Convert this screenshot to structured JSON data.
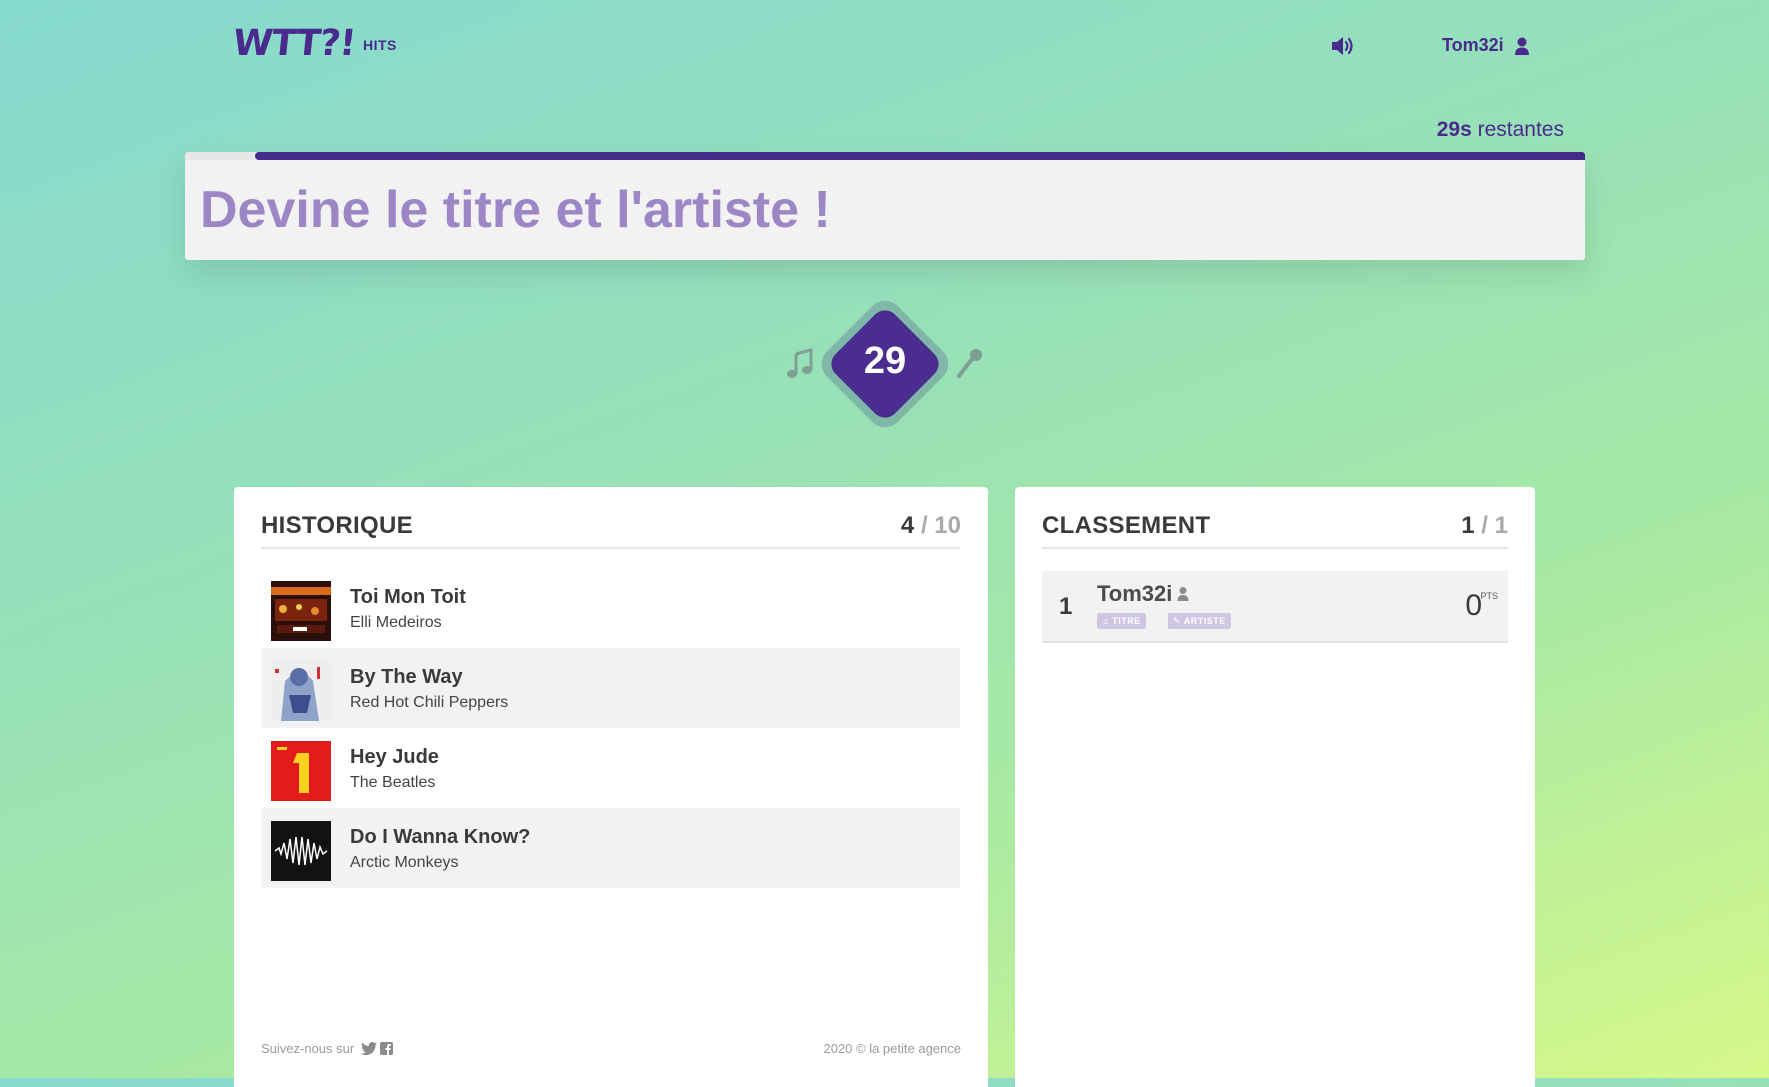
{
  "header": {
    "logo_text": "WTT?!",
    "logo_sub": "HITS",
    "username": "Tom32i"
  },
  "timer": {
    "seconds_label": "29s",
    "remaining_word": "restantes",
    "progress_fraction": 0.95
  },
  "question": {
    "text": "Devine le titre et l'artiste !"
  },
  "counter": {
    "value": "29"
  },
  "history": {
    "title": "HISTORIQUE",
    "current": "4",
    "separator": "/",
    "total": "10",
    "items": [
      {
        "title": "Toi Mon Toit",
        "artist": "Elli Medeiros"
      },
      {
        "title": "By The Way",
        "artist": "Red Hot Chili Peppers"
      },
      {
        "title": "Hey Jude",
        "artist": "The Beatles"
      },
      {
        "title": "Do I Wanna Know?",
        "artist": "Arctic Monkeys"
      }
    ],
    "footer_follow": "Suivez-nous sur",
    "footer_copy": "2020 © la petite agence"
  },
  "ranking": {
    "title": "CLASSEMENT",
    "current": "1",
    "separator": "/",
    "total": "1",
    "players": [
      {
        "position": "1",
        "name": "Tom32i",
        "tag_title": "TITRE",
        "tag_artist": "ARTISTE",
        "points": "0",
        "points_label": "PTS"
      }
    ]
  },
  "colors": {
    "brand_purple": "#4a2a8c",
    "question_text": "#9c86c5",
    "tag_bg": "#cfc6e2"
  }
}
